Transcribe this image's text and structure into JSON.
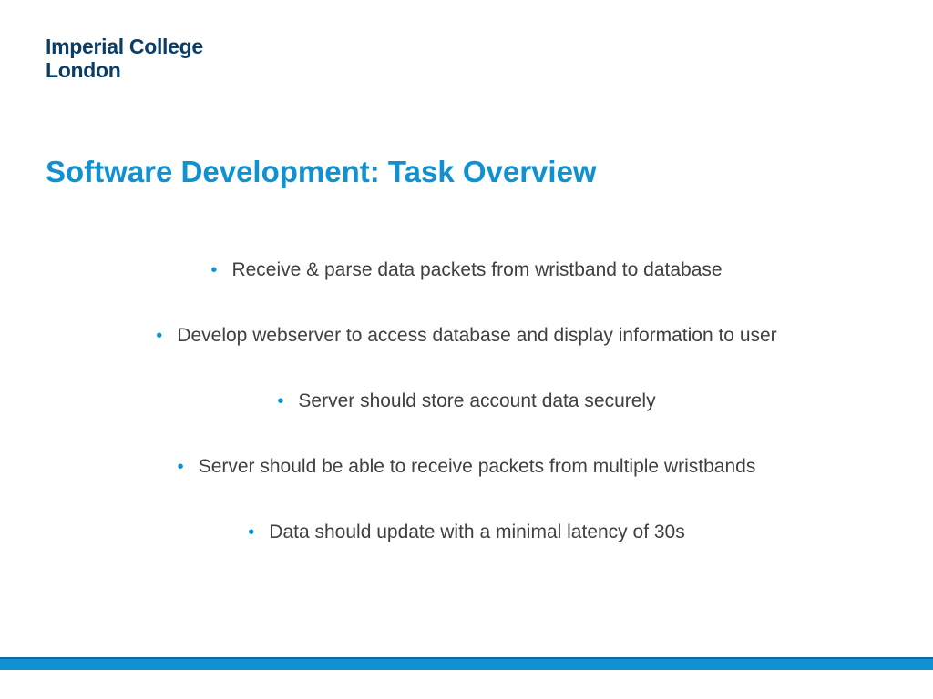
{
  "logo": {
    "line1": "Imperial College",
    "line2": "London"
  },
  "title": "Software Development: Task Overview",
  "bullets": [
    "Receive & parse data packets from wristband to database",
    "Develop webserver to access database and display information to user",
    "Server should store account data securely",
    "Server should be able to receive packets from multiple wristbands",
    "Data should update with a minimal latency of 30s"
  ],
  "colors": {
    "accent": "#1191d0",
    "logo": "#0b3e66",
    "text": "#404040"
  }
}
